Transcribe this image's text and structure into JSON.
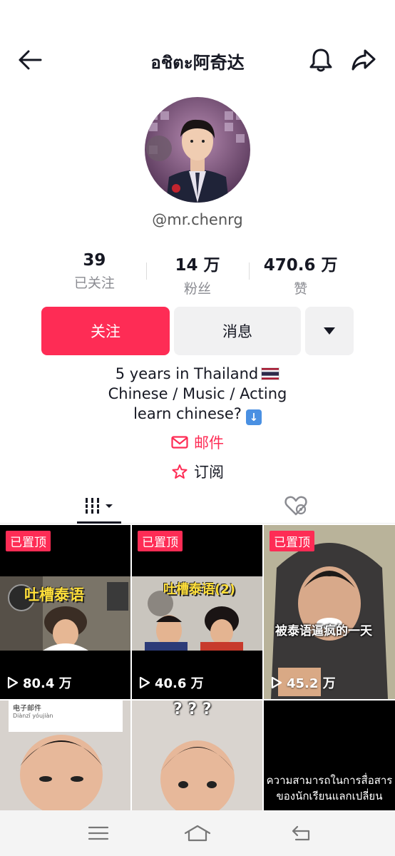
{
  "header": {
    "title": "อชิตะ阿奇达",
    "back_icon": "back-arrow-icon",
    "bell_icon": "bell-icon",
    "share_icon": "share-icon"
  },
  "profile": {
    "username": "@mr.chenrg",
    "stats": [
      {
        "value": "39",
        "label": "已关注"
      },
      {
        "value": "14 万",
        "label": "粉丝"
      },
      {
        "value": "470.6 万",
        "label": "赞"
      }
    ],
    "follow_label": "关注",
    "message_label": "消息",
    "bio": {
      "line1": "5 years in Thailand",
      "line2": "Chinese / Music / Acting",
      "line3": "learn chinese?"
    },
    "email_label": "邮件",
    "subscribe_label": "订阅"
  },
  "videos": [
    {
      "pinned": "已置顶",
      "views": "80.4 万",
      "caption": "吐槽泰语"
    },
    {
      "pinned": "已置顶",
      "views": "40.6 万",
      "caption": "吐槽泰语(2)"
    },
    {
      "pinned": "已置顶",
      "views": "45.2 万",
      "caption": "被泰语逼疯的一天"
    },
    {
      "dict_title": "电子邮件",
      "dict_pinyin": "Diànzǐ yóujiàn"
    },
    {
      "caption": "? ? ?"
    },
    {
      "caption_line1": "ความสามารถในการสื่อสาร",
      "caption_line2": "ของนักเรียนแลกเปลี่ยน"
    }
  ],
  "colors": {
    "accent": "#fe2c55",
    "button_gray": "#f1f1f2",
    "pin_badge": "#fe2c55"
  }
}
